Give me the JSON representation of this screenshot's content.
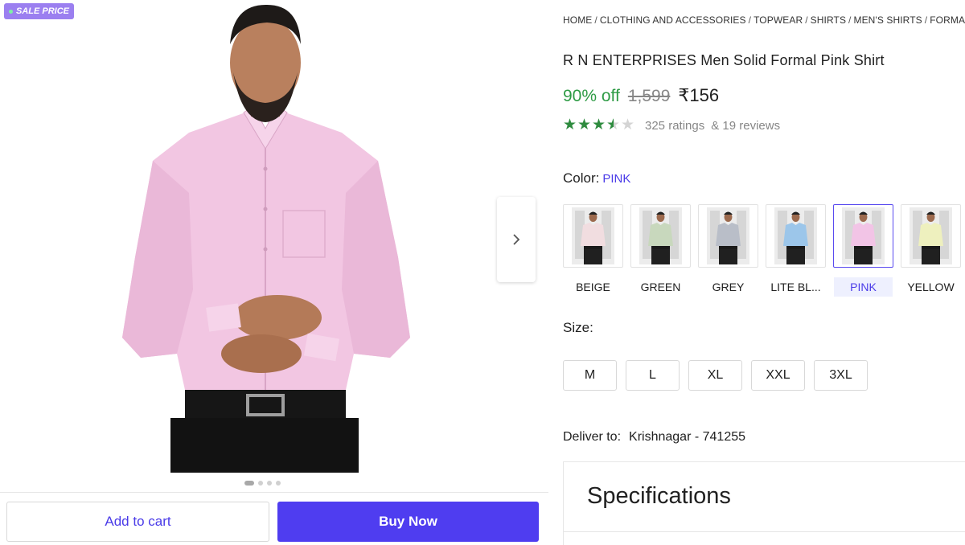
{
  "gallery": {
    "sale_badge": "SALE PRICE",
    "next_icon": "chevron-right-icon",
    "dot_count": 4,
    "active_dot": 0
  },
  "actions": {
    "add_to_cart": "Add to cart",
    "buy_now": "Buy Now",
    "accent_color": "#4f3df0"
  },
  "breadcrumb": [
    "HOME",
    "CLOTHING AND ACCESSORIES",
    "TOPWEAR",
    "SHIRTS",
    "MEN'S SHIRTS",
    "FORMAL"
  ],
  "product": {
    "title": "R N ENTERPRISES Men Solid Formal Pink Shirt",
    "discount": "90% off",
    "mrp": "1,599",
    "price": "₹156",
    "rating": 3.5,
    "ratings_text": "325 ratings",
    "reviews_text": "& 19 reviews"
  },
  "color": {
    "label": "Color:",
    "value": "PINK",
    "options": [
      {
        "label": "BEIGE",
        "shirt": "#f1dde0",
        "selected": false
      },
      {
        "label": "GREEN",
        "shirt": "#c8d8bd",
        "selected": false
      },
      {
        "label": "GREY",
        "shirt": "#b9bec8",
        "selected": false
      },
      {
        "label": "LITE BL...",
        "shirt": "#9cc6ea",
        "selected": false
      },
      {
        "label": "PINK",
        "shirt": "#f2c4e6",
        "selected": true
      },
      {
        "label": "YELLOW",
        "shirt": "#eef0be",
        "selected": false
      }
    ]
  },
  "size": {
    "label": "Size:",
    "options": [
      "M",
      "L",
      "XL",
      "XXL",
      "3XL"
    ]
  },
  "delivery": {
    "label": "Deliver to:",
    "location": "Krishnagar - 741255"
  },
  "specifications": {
    "title": "Specifications"
  }
}
